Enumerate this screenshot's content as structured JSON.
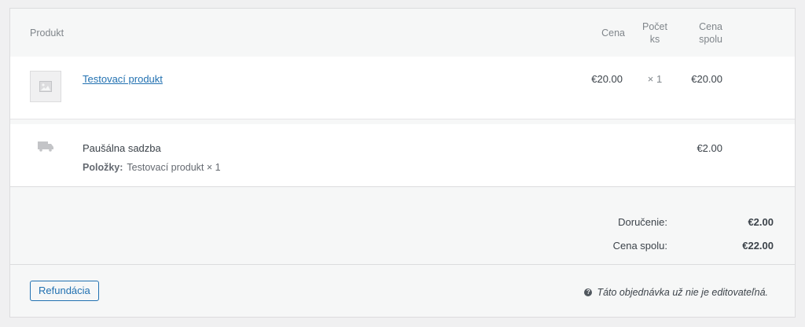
{
  "table": {
    "headers": {
      "product": "Produkt",
      "price": "Cena",
      "qty": "Počet ks",
      "total": "Cena spolu"
    }
  },
  "items": [
    {
      "name": "Testovací produkt",
      "price": "€20.00",
      "qty": "× 1",
      "total": "€20.00",
      "thumbnail_icon": "image-placeholder-icon"
    }
  ],
  "shipping": {
    "name": "Paušálna sadzba",
    "meta_label": "Položky:",
    "meta_value": "Testovací produkt × 1",
    "total": "€2.00",
    "icon": "truck-icon"
  },
  "totals": {
    "shipping_label": "Doručenie:",
    "shipping_value": "€2.00",
    "order_label": "Cena spolu:",
    "order_value": "€22.00"
  },
  "footer": {
    "refund_label": "Refundácia",
    "notice_text": "Táto objednávka už nie je editovateľná.",
    "notice_icon": "help-icon"
  },
  "colors": {
    "link": "#2271b1",
    "text": "#3c434a",
    "muted": "#80868b",
    "background": "#f6f7f7"
  }
}
